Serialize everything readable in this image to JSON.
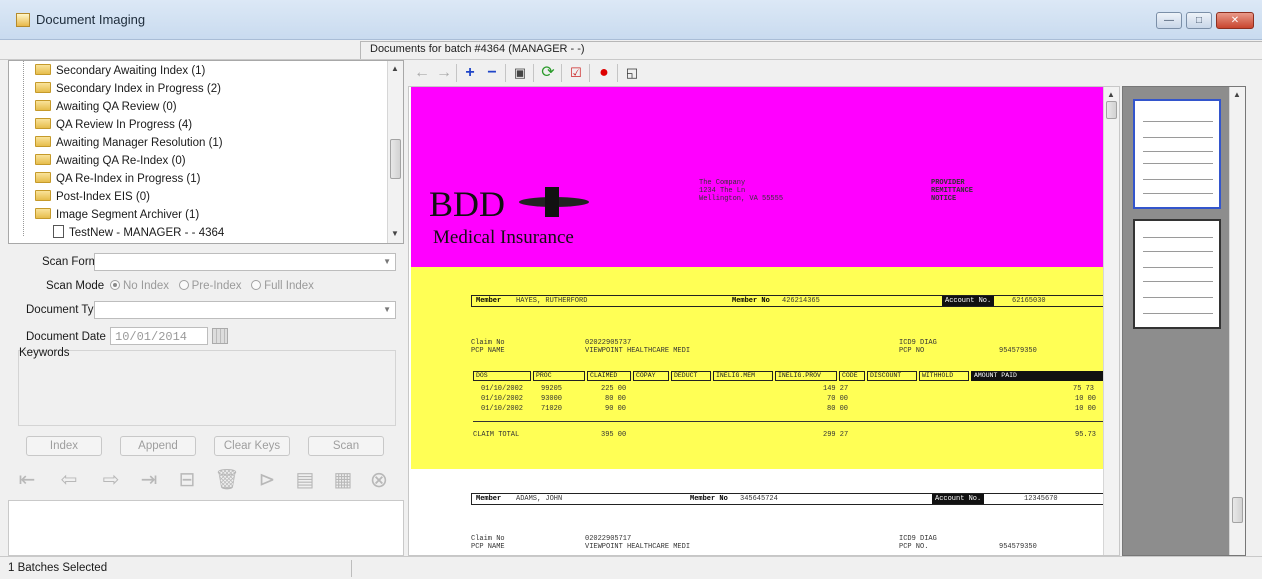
{
  "window": {
    "title": "Document Imaging",
    "buttons": {
      "minimize": "—",
      "maximize": "□",
      "close": "✕"
    }
  },
  "header": {
    "batch_label": "Documents for batch #4364 (MANAGER - -)"
  },
  "tree": {
    "items": [
      {
        "label": "Secondary Awaiting Index (1)"
      },
      {
        "label": "Secondary Index in Progress (2)"
      },
      {
        "label": "Awaiting QA Review (0)"
      },
      {
        "label": "QA Review In Progress (4)"
      },
      {
        "label": "Awaiting Manager Resolution (1)"
      },
      {
        "label": "Awaiting QA Re-Index (0)"
      },
      {
        "label": "QA Re-Index in Progress (1)"
      },
      {
        "label": "Post-Index EIS (0)"
      },
      {
        "label": "Image Segment Archiver (1)"
      }
    ],
    "child": {
      "label": "TestNew - MANAGER - - 4364"
    }
  },
  "form": {
    "scan_format_label": "Scan Format",
    "scan_mode_label": "Scan Mode",
    "scan_mode_options": [
      "No Index",
      "Pre-Index",
      "Full Index"
    ],
    "scan_mode_selected": "No Index",
    "document_type_label": "Document Type",
    "document_date_label": "Document Date",
    "document_date_value": "10/01/2014",
    "keywords_label": "Keywords"
  },
  "actions": {
    "index": "Index",
    "append": "Append",
    "clear_keys": "Clear Keys",
    "scan": "Scan"
  },
  "nav_icons": [
    "move-first-icon",
    "move-prev-icon",
    "move-next-icon",
    "move-last-icon",
    "split-icon",
    "delete-icon",
    "insert-icon",
    "page-icon",
    "document-icon",
    "cancel-icon"
  ],
  "toolbar_icons": [
    "back-arrow-icon",
    "forward-arrow-icon",
    "zoom-in-icon",
    "zoom-out-icon",
    "fit-page-icon",
    "rotate-icon",
    "annotate-icon",
    "record-icon",
    "window-icon"
  ],
  "document": {
    "logo_main": "BDD",
    "logo_sub": "Medical Insurance",
    "company": [
      "The Company",
      "1234 The Ln",
      "Wellington, VA 55555"
    ],
    "notice": [
      "PROVIDER",
      "REMITTANCE",
      "NOTICE"
    ],
    "claim1": {
      "member_label": "Member",
      "member_name": "HAYES, RUTHERFORD",
      "member_no_label": "Member No",
      "member_no": "426214365",
      "account_label": "Account No.",
      "account_no": "62165030",
      "claim_no_label": "Claim No",
      "claim_no": "02022905737",
      "pcp_label": "PCP NAME",
      "pcp_name": "VIEWPOINT HEALTHCARE MEDI",
      "icd_label": "ICD9 DIAG",
      "pcp_no_label": "PCP NO",
      "pcp_no": "954579350",
      "columns": [
        "DOS",
        "PROC",
        "CLAIMED",
        "COPAY",
        "DEDUCT",
        "INELIG.MEM",
        "INELIG.PROV",
        "CODE",
        "DISCOUNT",
        "WITHHOLD",
        "AMOUNT PAID"
      ],
      "rows": [
        {
          "dos": "01/10/2002",
          "proc": "99205",
          "claimed": "225 00",
          "inelig": "149 27",
          "paid": "75 73"
        },
        {
          "dos": "01/10/2002",
          "proc": "93000",
          "claimed": "80 00",
          "inelig": "70 00",
          "paid": "10 00"
        },
        {
          "dos": "01/10/2002",
          "proc": "71020",
          "claimed": "90 00",
          "inelig": "80 00",
          "paid": "10 00"
        }
      ],
      "total_label": "CLAIM TOTAL",
      "total_claimed": "395 00",
      "total_inelig": "299 27",
      "total_paid": "95.73"
    },
    "claim2": {
      "member_label": "Member",
      "member_name": "ADAMS, JOHN",
      "member_no_label": "Member No",
      "member_no": "345645724",
      "account_label": "Account No.",
      "account_no": "12345670",
      "claim_no_label": "Claim No",
      "claim_no": "02022905717",
      "pcp_label": "PCP NAME",
      "pcp_name": "VIEWPOINT HEALTHCARE MEDI",
      "icd_label": "ICD9 DIAG",
      "pcp_no_label": "PCP NO.",
      "pcp_no": "954579350"
    }
  },
  "status": {
    "text": "1 Batches Selected"
  }
}
